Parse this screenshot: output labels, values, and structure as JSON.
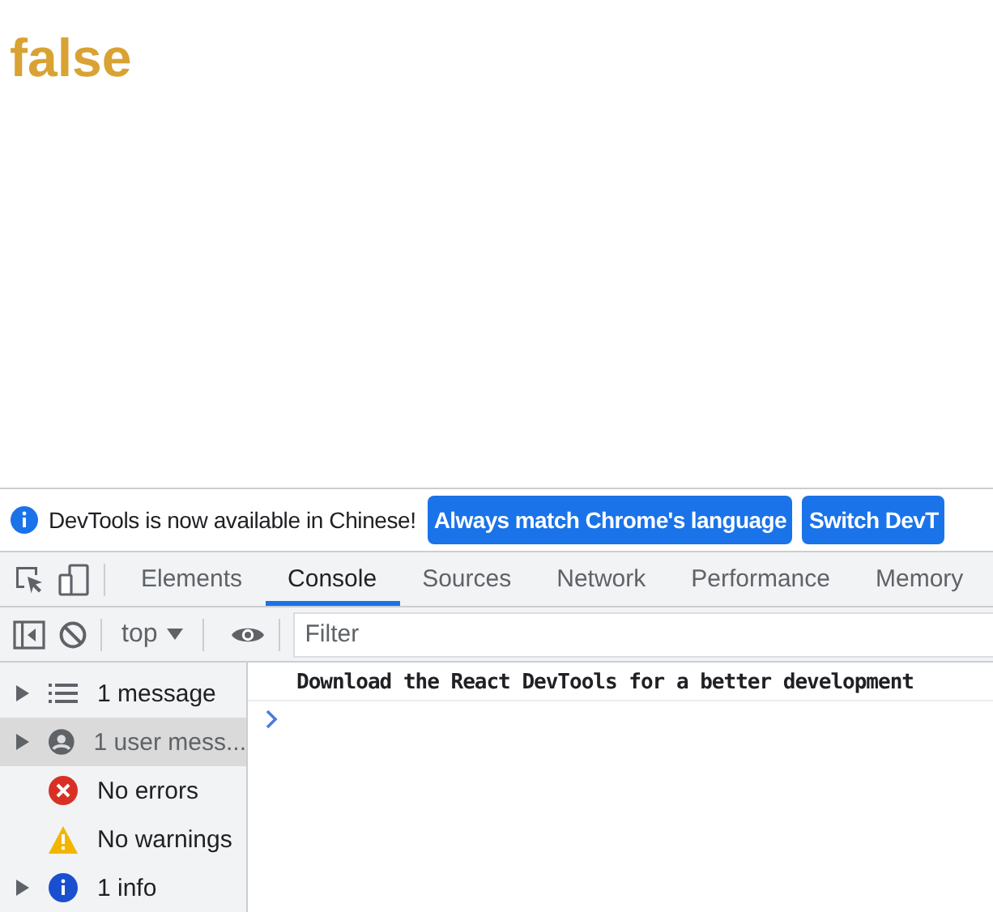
{
  "page": {
    "output": "false"
  },
  "infobar": {
    "message": "DevTools is now available in Chinese!",
    "buttons": [
      "Always match Chrome's language",
      "Switch DevT"
    ]
  },
  "tabs": [
    {
      "label": "Elements",
      "selected": false
    },
    {
      "label": "Console",
      "selected": true
    },
    {
      "label": "Sources",
      "selected": false
    },
    {
      "label": "Network",
      "selected": false
    },
    {
      "label": "Performance",
      "selected": false
    },
    {
      "label": "Memory",
      "selected": false
    }
  ],
  "toolbar": {
    "context": "top",
    "filter": {
      "placeholder": "Filter"
    }
  },
  "sidebar": {
    "items": [
      {
        "kind": "messages",
        "label": "1 message",
        "expandable": true,
        "selected": false
      },
      {
        "kind": "user",
        "label": "1 user mess...",
        "expandable": true,
        "selected": true
      },
      {
        "kind": "errors",
        "label": "No errors",
        "expandable": false,
        "selected": false
      },
      {
        "kind": "warnings",
        "label": "No warnings",
        "expandable": false,
        "selected": false
      },
      {
        "kind": "info",
        "label": "1 info",
        "expandable": true,
        "selected": false
      }
    ]
  },
  "console": {
    "messages": [
      "Download the React DevTools for a better development"
    ]
  }
}
